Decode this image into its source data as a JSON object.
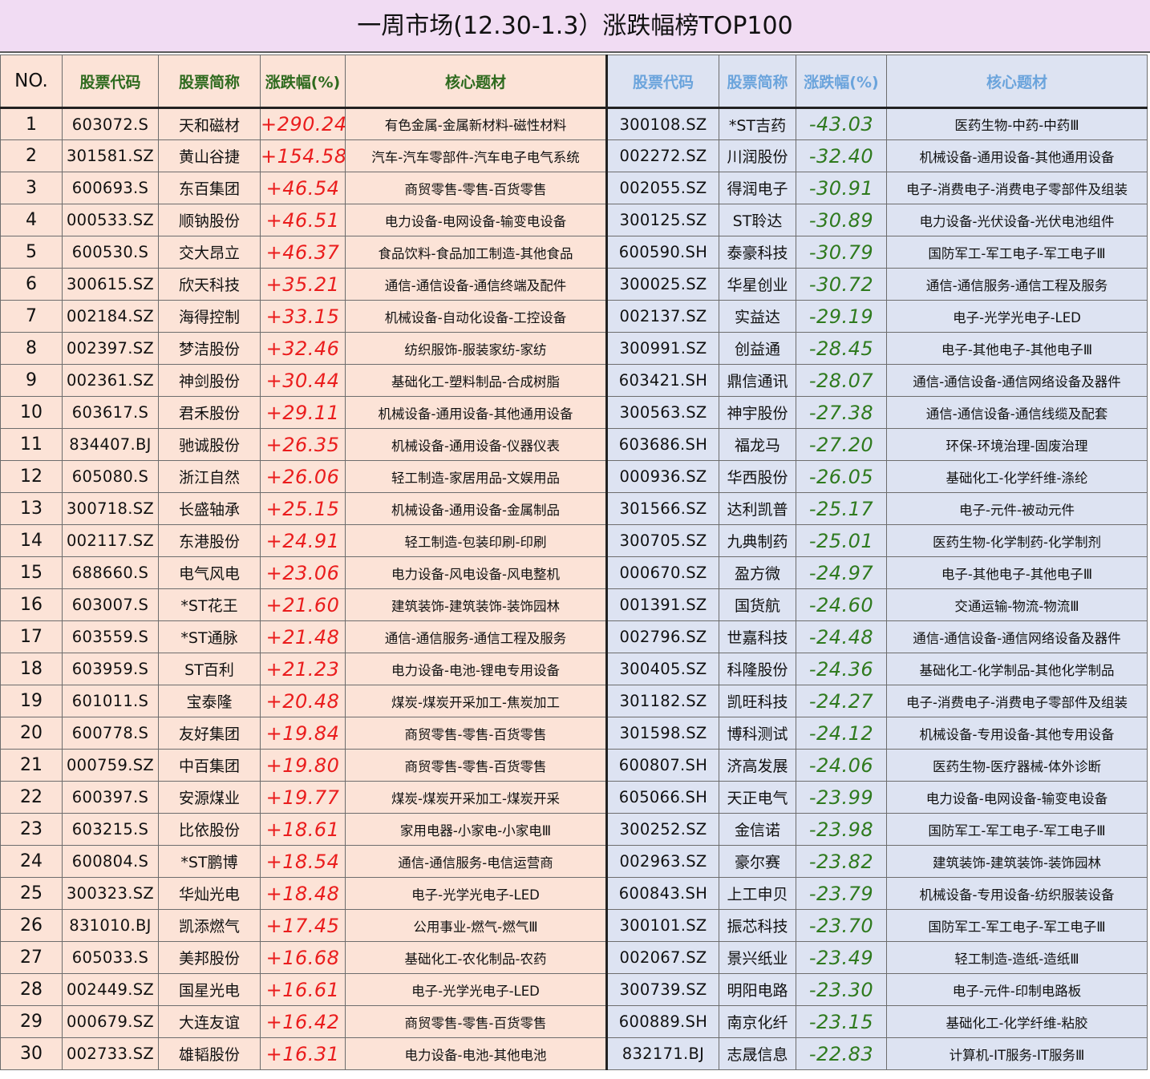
{
  "title": "一周市场(12.30-1.3）涨跌幅榜TOP100",
  "headers": {
    "no": "NO.",
    "left": {
      "code": "股票代码",
      "name": "股票简称",
      "change": "涨跌幅(%)",
      "theme": "核心题材"
    },
    "right": {
      "code": "股票代码",
      "name": "股票简称",
      "change": "涨跌幅(%)",
      "theme": "核心题材"
    }
  },
  "colors": {
    "gain": "#ea1d1d",
    "loss": "#2f7a1e",
    "left_bg": "#fce3d7",
    "right_bg": "#dde3f2",
    "title_bg": "#f1dcf3"
  },
  "rows": [
    {
      "no": "1",
      "gain_code": "603072.S",
      "gain_name": "天和磁材",
      "gain_pct": "+290.24",
      "gain_theme": "有色金属-金属新材料-磁性材料",
      "loss_code": "300108.SZ",
      "loss_name": "*ST吉药",
      "loss_pct": "-43.03",
      "loss_theme": "医药生物-中药-中药Ⅲ"
    },
    {
      "no": "2",
      "gain_code": "301581.SZ",
      "gain_name": "黄山谷捷",
      "gain_pct": "+154.58",
      "gain_theme": "汽车-汽车零部件-汽车电子电气系统",
      "loss_code": "002272.SZ",
      "loss_name": "川润股份",
      "loss_pct": "-32.40",
      "loss_theme": "机械设备-通用设备-其他通用设备"
    },
    {
      "no": "3",
      "gain_code": "600693.S",
      "gain_name": "东百集团",
      "gain_pct": "+46.54",
      "gain_theme": "商贸零售-零售-百货零售",
      "loss_code": "002055.SZ",
      "loss_name": "得润电子",
      "loss_pct": "-30.91",
      "loss_theme": "电子-消费电子-消费电子零部件及组装"
    },
    {
      "no": "4",
      "gain_code": "000533.SZ",
      "gain_name": "顺钠股份",
      "gain_pct": "+46.51",
      "gain_theme": "电力设备-电网设备-输变电设备",
      "loss_code": "300125.SZ",
      "loss_name": "ST聆达",
      "loss_pct": "-30.89",
      "loss_theme": "电力设备-光伏设备-光伏电池组件"
    },
    {
      "no": "5",
      "gain_code": "600530.S",
      "gain_name": "交大昂立",
      "gain_pct": "+46.37",
      "gain_theme": "食品饮料-食品加工制造-其他食品",
      "loss_code": "600590.SH",
      "loss_name": "泰豪科技",
      "loss_pct": "-30.79",
      "loss_theme": "国防军工-军工电子-军工电子Ⅲ"
    },
    {
      "no": "6",
      "gain_code": "300615.SZ",
      "gain_name": "欣天科技",
      "gain_pct": "+35.21",
      "gain_theme": "通信-通信设备-通信终端及配件",
      "loss_code": "300025.SZ",
      "loss_name": "华星创业",
      "loss_pct": "-30.72",
      "loss_theme": "通信-通信服务-通信工程及服务"
    },
    {
      "no": "7",
      "gain_code": "002184.SZ",
      "gain_name": "海得控制",
      "gain_pct": "+33.15",
      "gain_theme": "机械设备-自动化设备-工控设备",
      "loss_code": "002137.SZ",
      "loss_name": "实益达",
      "loss_pct": "-29.19",
      "loss_theme": "电子-光学光电子-LED"
    },
    {
      "no": "8",
      "gain_code": "002397.SZ",
      "gain_name": "梦洁股份",
      "gain_pct": "+32.46",
      "gain_theme": "纺织服饰-服装家纺-家纺",
      "loss_code": "300991.SZ",
      "loss_name": "创益通",
      "loss_pct": "-28.45",
      "loss_theme": "电子-其他电子-其他电子Ⅲ"
    },
    {
      "no": "9",
      "gain_code": "002361.SZ",
      "gain_name": "神剑股份",
      "gain_pct": "+30.44",
      "gain_theme": "基础化工-塑料制品-合成树脂",
      "loss_code": "603421.SH",
      "loss_name": "鼎信通讯",
      "loss_pct": "-28.07",
      "loss_theme": "通信-通信设备-通信网络设备及器件"
    },
    {
      "no": "10",
      "gain_code": "603617.S",
      "gain_name": "君禾股份",
      "gain_pct": "+29.11",
      "gain_theme": "机械设备-通用设备-其他通用设备",
      "loss_code": "300563.SZ",
      "loss_name": "神宇股份",
      "loss_pct": "-27.38",
      "loss_theme": "通信-通信设备-通信线缆及配套"
    },
    {
      "no": "11",
      "gain_code": "834407.BJ",
      "gain_name": "驰诚股份",
      "gain_pct": "+26.35",
      "gain_theme": "机械设备-通用设备-仪器仪表",
      "loss_code": "603686.SH",
      "loss_name": "福龙马",
      "loss_pct": "-27.20",
      "loss_theme": "环保-环境治理-固废治理"
    },
    {
      "no": "12",
      "gain_code": "605080.S",
      "gain_name": "浙江自然",
      "gain_pct": "+26.06",
      "gain_theme": "轻工制造-家居用品-文娱用品",
      "loss_code": "000936.SZ",
      "loss_name": "华西股份",
      "loss_pct": "-26.05",
      "loss_theme": "基础化工-化学纤维-涤纶"
    },
    {
      "no": "13",
      "gain_code": "300718.SZ",
      "gain_name": "长盛轴承",
      "gain_pct": "+25.15",
      "gain_theme": "机械设备-通用设备-金属制品",
      "loss_code": "301566.SZ",
      "loss_name": "达利凯普",
      "loss_pct": "-25.17",
      "loss_theme": "电子-元件-被动元件"
    },
    {
      "no": "14",
      "gain_code": "002117.SZ",
      "gain_name": "东港股份",
      "gain_pct": "+24.91",
      "gain_theme": "轻工制造-包装印刷-印刷",
      "loss_code": "300705.SZ",
      "loss_name": "九典制药",
      "loss_pct": "-25.01",
      "loss_theme": "医药生物-化学制药-化学制剂"
    },
    {
      "no": "15",
      "gain_code": "688660.S",
      "gain_name": "电气风电",
      "gain_pct": "+23.06",
      "gain_theme": "电力设备-风电设备-风电整机",
      "loss_code": "000670.SZ",
      "loss_name": "盈方微",
      "loss_pct": "-24.97",
      "loss_theme": "电子-其他电子-其他电子Ⅲ"
    },
    {
      "no": "16",
      "gain_code": "603007.S",
      "gain_name": "*ST花王",
      "gain_pct": "+21.60",
      "gain_theme": "建筑装饰-建筑装饰-装饰园林",
      "loss_code": "001391.SZ",
      "loss_name": "国货航",
      "loss_pct": "-24.60",
      "loss_theme": "交通运输-物流-物流Ⅲ"
    },
    {
      "no": "17",
      "gain_code": "603559.S",
      "gain_name": "*ST通脉",
      "gain_pct": "+21.48",
      "gain_theme": "通信-通信服务-通信工程及服务",
      "loss_code": "002796.SZ",
      "loss_name": "世嘉科技",
      "loss_pct": "-24.48",
      "loss_theme": "通信-通信设备-通信网络设备及器件"
    },
    {
      "no": "18",
      "gain_code": "603959.S",
      "gain_name": "ST百利",
      "gain_pct": "+21.23",
      "gain_theme": "电力设备-电池-锂电专用设备",
      "loss_code": "300405.SZ",
      "loss_name": "科隆股份",
      "loss_pct": "-24.36",
      "loss_theme": "基础化工-化学制品-其他化学制品"
    },
    {
      "no": "19",
      "gain_code": "601011.S",
      "gain_name": "宝泰隆",
      "gain_pct": "+20.48",
      "gain_theme": "煤炭-煤炭开采加工-焦炭加工",
      "loss_code": "301182.SZ",
      "loss_name": "凯旺科技",
      "loss_pct": "-24.27",
      "loss_theme": "电子-消费电子-消费电子零部件及组装"
    },
    {
      "no": "20",
      "gain_code": "600778.S",
      "gain_name": "友好集团",
      "gain_pct": "+19.84",
      "gain_theme": "商贸零售-零售-百货零售",
      "loss_code": "301598.SZ",
      "loss_name": "博科测试",
      "loss_pct": "-24.12",
      "loss_theme": "机械设备-专用设备-其他专用设备"
    },
    {
      "no": "21",
      "gain_code": "000759.SZ",
      "gain_name": "中百集团",
      "gain_pct": "+19.80",
      "gain_theme": "商贸零售-零售-百货零售",
      "loss_code": "600807.SH",
      "loss_name": "济高发展",
      "loss_pct": "-24.06",
      "loss_theme": "医药生物-医疗器械-体外诊断"
    },
    {
      "no": "22",
      "gain_code": "600397.S",
      "gain_name": "安源煤业",
      "gain_pct": "+19.77",
      "gain_theme": "煤炭-煤炭开采加工-煤炭开采",
      "loss_code": "605066.SH",
      "loss_name": "天正电气",
      "loss_pct": "-23.99",
      "loss_theme": "电力设备-电网设备-输变电设备"
    },
    {
      "no": "23",
      "gain_code": "603215.S",
      "gain_name": "比依股份",
      "gain_pct": "+18.61",
      "gain_theme": "家用电器-小家电-小家电Ⅲ",
      "loss_code": "300252.SZ",
      "loss_name": "金信诺",
      "loss_pct": "-23.98",
      "loss_theme": "国防军工-军工电子-军工电子Ⅲ"
    },
    {
      "no": "24",
      "gain_code": "600804.S",
      "gain_name": "*ST鹏博",
      "gain_pct": "+18.54",
      "gain_theme": "通信-通信服务-电信运营商",
      "loss_code": "002963.SZ",
      "loss_name": "豪尔赛",
      "loss_pct": "-23.82",
      "loss_theme": "建筑装饰-建筑装饰-装饰园林"
    },
    {
      "no": "25",
      "gain_code": "300323.SZ",
      "gain_name": "华灿光电",
      "gain_pct": "+18.48",
      "gain_theme": "电子-光学光电子-LED",
      "loss_code": "600843.SH",
      "loss_name": "上工申贝",
      "loss_pct": "-23.79",
      "loss_theme": "机械设备-专用设备-纺织服装设备"
    },
    {
      "no": "26",
      "gain_code": "831010.BJ",
      "gain_name": "凯添燃气",
      "gain_pct": "+17.45",
      "gain_theme": "公用事业-燃气-燃气Ⅲ",
      "loss_code": "300101.SZ",
      "loss_name": "振芯科技",
      "loss_pct": "-23.70",
      "loss_theme": "国防军工-军工电子-军工电子Ⅲ"
    },
    {
      "no": "27",
      "gain_code": "605033.S",
      "gain_name": "美邦股份",
      "gain_pct": "+16.68",
      "gain_theme": "基础化工-农化制品-农药",
      "loss_code": "002067.SZ",
      "loss_name": "景兴纸业",
      "loss_pct": "-23.49",
      "loss_theme": "轻工制造-造纸-造纸Ⅲ"
    },
    {
      "no": "28",
      "gain_code": "002449.SZ",
      "gain_name": "国星光电",
      "gain_pct": "+16.61",
      "gain_theme": "电子-光学光电子-LED",
      "loss_code": "300739.SZ",
      "loss_name": "明阳电路",
      "loss_pct": "-23.30",
      "loss_theme": "电子-元件-印制电路板"
    },
    {
      "no": "29",
      "gain_code": "000679.SZ",
      "gain_name": "大连友谊",
      "gain_pct": "+16.42",
      "gain_theme": "商贸零售-零售-百货零售",
      "loss_code": "600889.SH",
      "loss_name": "南京化纤",
      "loss_pct": "-23.15",
      "loss_theme": "基础化工-化学纤维-粘胶"
    },
    {
      "no": "30",
      "gain_code": "002733.SZ",
      "gain_name": "雄韬股份",
      "gain_pct": "+16.31",
      "gain_theme": "电力设备-电池-其他电池",
      "loss_code": "832171.BJ",
      "loss_name": "志晟信息",
      "loss_pct": "-22.83",
      "loss_theme": "计算机-IT服务-IT服务Ⅲ"
    }
  ]
}
